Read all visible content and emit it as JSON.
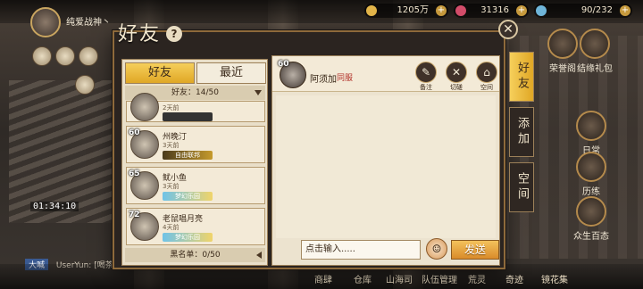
{
  "top_bar": {
    "player_name": "纯爱战神丶",
    "resource_1": "1205万",
    "resource_2": "31316",
    "resource_3": "90/232"
  },
  "modal": {
    "title": "好友",
    "close": "✕"
  },
  "friend_list": {
    "tabs": [
      "好友",
      "最近"
    ],
    "count": "好友：14/50",
    "blacklist": "黑名单：0/50",
    "friends": [
      {
        "level": "",
        "name": "",
        "time": "2天前",
        "badge": ""
      },
      {
        "level": "60",
        "name": "州晚汀",
        "time": "3天前",
        "badge": "自由联邦"
      },
      {
        "level": "65",
        "name": "鱿小鱼",
        "time": "3天前",
        "badge": "梦幻乐园"
      },
      {
        "level": "72",
        "name": "老鼠唱月亮",
        "time": "4天前",
        "badge": "梦幻乐园"
      }
    ]
  },
  "chat": {
    "level": "60",
    "name": "阿须加",
    "relation": "同服",
    "buttons": [
      "备注",
      "切磋",
      "空间"
    ],
    "input_placeholder": "点击输入.....",
    "send": "发送"
  },
  "side_tabs": [
    "好友",
    "添加",
    "空间"
  ],
  "right_menu": [
    "荣誉阁",
    "结缘礼包",
    "日常",
    "历练",
    "众生百态"
  ],
  "bottom_nav": [
    "商肆",
    "仓库",
    "山海司",
    "队伍管理",
    "荒灵",
    "奇迹",
    "镜花集"
  ],
  "timer": "01:34:10",
  "chat_feed": {
    "tag": "大喊",
    "user": "UserYun:",
    "text": "[喝茶]"
  },
  "colors": {
    "accent": "#e0a725",
    "frame": "#8e6a3b",
    "panel": "#e9dfc9",
    "relation": "#b3342c"
  }
}
